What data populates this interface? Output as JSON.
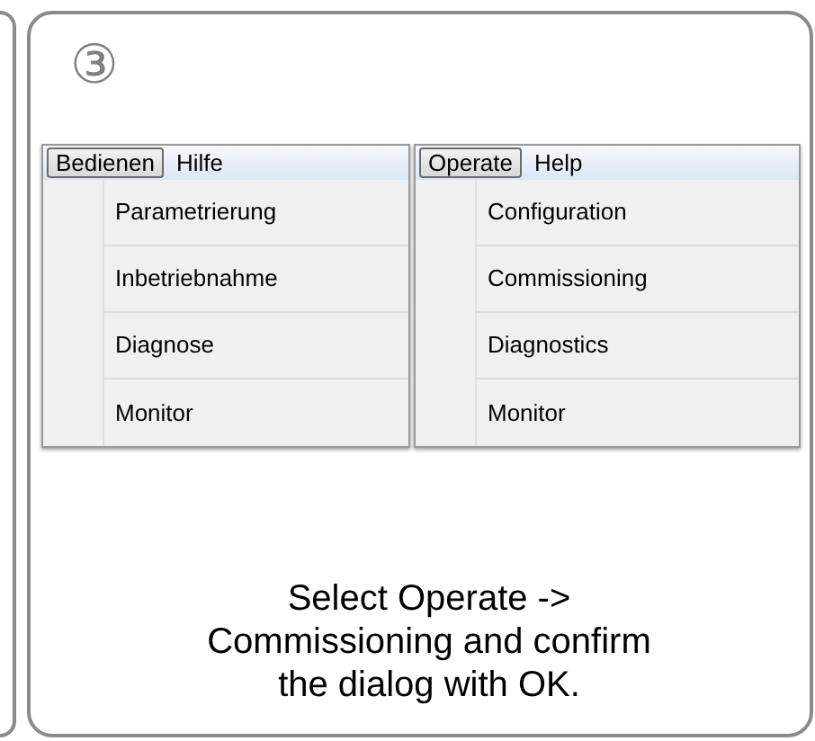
{
  "step": "③",
  "menus": [
    {
      "menu_bar": [
        {
          "label": "Bedienen",
          "selected": true
        },
        {
          "label": "Hilfe",
          "selected": false
        }
      ],
      "items": [
        "Parametrierung",
        "Inbetriebnahme",
        "Diagnose",
        "Monitor"
      ]
    },
    {
      "menu_bar": [
        {
          "label": "Operate",
          "selected": true
        },
        {
          "label": "Help",
          "selected": false
        }
      ],
      "items": [
        "Configuration",
        "Commissioning",
        "Diagnostics",
        "Monitor"
      ]
    }
  ],
  "instruction_lines": [
    "Select Operate ->",
    "Commissioning and confirm",
    "the dialog with OK."
  ]
}
